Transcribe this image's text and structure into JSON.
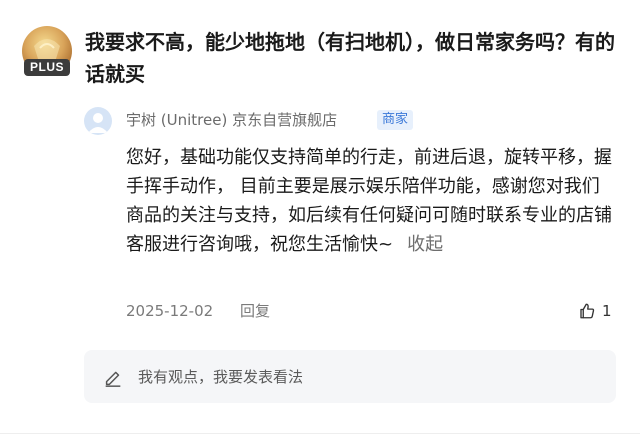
{
  "question": {
    "badge": "PLUS",
    "text": "我要求不高，能少地拖地（有扫地机），做日常家务吗？有的话就买"
  },
  "answer": {
    "shop_name": "宇树 (Unitree) 京东自营旗舰店",
    "tag": "商家",
    "body": "您好，基础功能仅支持简单的行走，前进后退，旋转平移，握手挥手动作， 目前主要是展示娱乐陪伴功能，感谢您对我们商品的关注与支持，如后续有任何疑问可随时联系专业的店铺客服进行咨询哦，祝您生活愉快~",
    "collapse_label": "收起",
    "date": "2025-12-02",
    "reply_label": "回复",
    "like_count": "1"
  },
  "comment_input": {
    "placeholder": "我有观点，我要发表看法"
  },
  "colors": {
    "merchant_tag_bg": "#e7f0fc",
    "merchant_tag_text": "#3a78d8",
    "input_bg": "#f5f6f8"
  },
  "icons": {
    "like": "thumbs-up-icon",
    "comment": "pencil-icon",
    "user": "default-user-icon"
  }
}
